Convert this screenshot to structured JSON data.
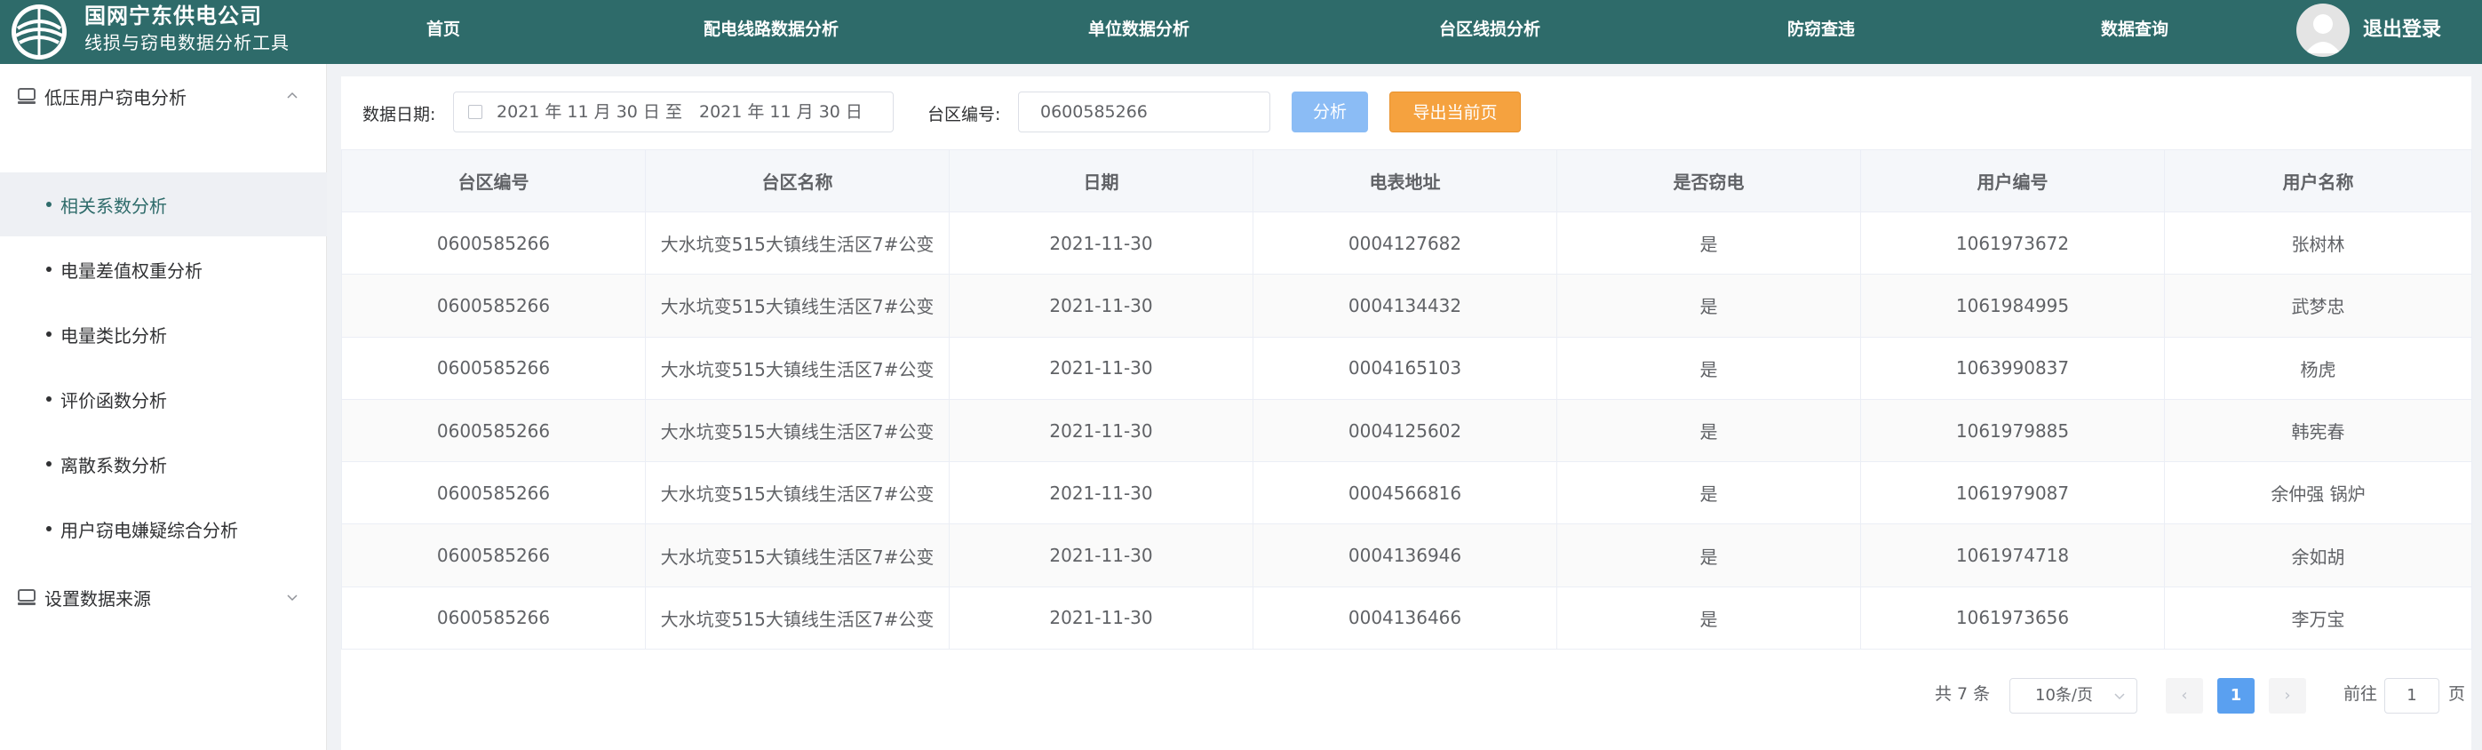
{
  "header": {
    "brand_title": "国网宁东供电公司",
    "brand_subtitle": "线损与窃电数据分析工具",
    "nav": [
      "首页",
      "配电线路数据分析",
      "单位数据分析",
      "台区线损分析",
      "防窃查违",
      "数据查询"
    ],
    "logout": "退出登录",
    "accent": "#2e6b6a"
  },
  "sidebar": {
    "group1": "低压用户窃电分析",
    "items": [
      "相关系数分析",
      "电量差值权重分析",
      "电量类比分析",
      "评价函数分析",
      "离散系数分析",
      "用户窃电嫌疑综合分析"
    ],
    "active_index": 0,
    "group2": "设置数据来源"
  },
  "filters": {
    "date_label": "数据日期:",
    "date_start": "2021 年 11 月 30 日",
    "date_sep": "至",
    "date_end": "2021 年 11 月 30 日",
    "area_label": "台区编号:",
    "area_value": "0600585266",
    "analyze_button": "分析",
    "export_button": "导出当前页"
  },
  "table": {
    "columns": [
      "台区编号",
      "台区名称",
      "日期",
      "电表地址",
      "是否窃电",
      "用户编号",
      "用户名称"
    ],
    "rows": [
      [
        "0600585266",
        "大水坑变515大镇线生活区7#公变",
        "2021-11-30",
        "0004127682",
        "是",
        "1061973672",
        "张树林"
      ],
      [
        "0600585266",
        "大水坑变515大镇线生活区7#公变",
        "2021-11-30",
        "0004134432",
        "是",
        "1061984995",
        "武梦忠"
      ],
      [
        "0600585266",
        "大水坑变515大镇线生活区7#公变",
        "2021-11-30",
        "0004165103",
        "是",
        "1063990837",
        "杨虎"
      ],
      [
        "0600585266",
        "大水坑变515大镇线生活区7#公变",
        "2021-11-30",
        "0004125602",
        "是",
        "1061979885",
        "韩宪春"
      ],
      [
        "0600585266",
        "大水坑变515大镇线生活区7#公变",
        "2021-11-30",
        "0004566816",
        "是",
        "1061979087",
        "余仲强 锅炉"
      ],
      [
        "0600585266",
        "大水坑变515大镇线生活区7#公变",
        "2021-11-30",
        "0004136946",
        "是",
        "1061974718",
        "余如胡"
      ],
      [
        "0600585266",
        "大水坑变515大镇线生活区7#公变",
        "2021-11-30",
        "0004136466",
        "是",
        "1061973656",
        "李万宝"
      ]
    ]
  },
  "pagination": {
    "total": "共 7 条",
    "page_size": "10条/页",
    "prev": "‹",
    "current": "1",
    "next": "›",
    "goto_label": "前往",
    "goto_value": "1",
    "page_unit": "页"
  }
}
